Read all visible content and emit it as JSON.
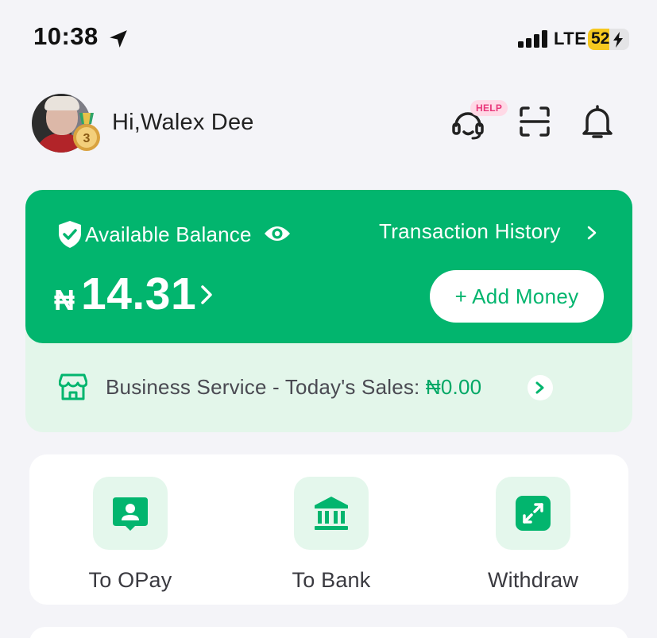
{
  "status_bar": {
    "time": "10:38",
    "network": "LTE",
    "battery_percent": "52",
    "battery_level": 0.52
  },
  "header": {
    "greeting": "Hi,Walex Dee",
    "avatar_icon": "user-avatar",
    "medal_level": "3",
    "help_badge": "HELP"
  },
  "balance": {
    "label": "Available Balance",
    "transaction_history": "Transaction History",
    "currency_symbol": "₦",
    "amount": "14.31",
    "add_money": "+ Add Money"
  },
  "business": {
    "label": "Business Service - Today's Sales: ",
    "sales_amount": "₦0.00"
  },
  "actions": [
    {
      "label": "To OPay",
      "icon": "opay-user-icon"
    },
    {
      "label": "To Bank",
      "icon": "bank-icon"
    },
    {
      "label": "Withdraw",
      "icon": "withdraw-icon"
    }
  ],
  "colors": {
    "brand_green": "#02b56e",
    "light_green": "#e3f6ea",
    "page_background": "#f4f4f8",
    "help_pink": "#e8367a",
    "battery_yellow": "#f6c81f"
  }
}
